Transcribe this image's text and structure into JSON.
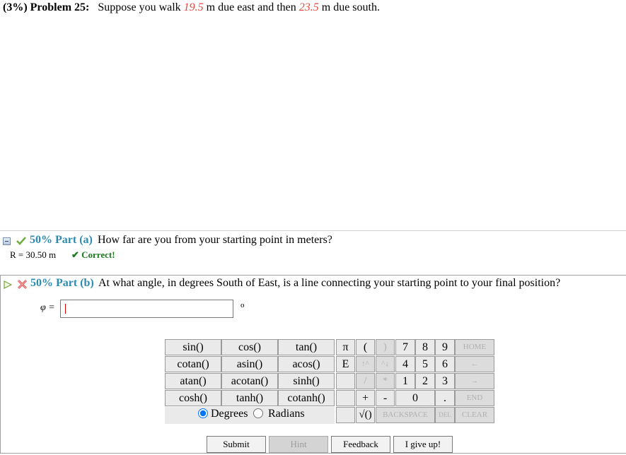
{
  "problem": {
    "points": "(3%)",
    "label": "Problem 25:",
    "text_1": "Suppose you walk",
    "east": "19.5",
    "text_2": "m due east and then",
    "south": "23.5",
    "text_3": "m due south."
  },
  "part_a": {
    "title": "50% Part (a)",
    "question": "How far are you from your starting point in meters?",
    "answer": "R = 30.50 m",
    "status": "✔ Correct!",
    "status_color": "#1a7a1a"
  },
  "part_b": {
    "title": "50% Part (b)",
    "question": "At what angle, in degrees South of East, is a line connecting your starting point to your final position?",
    "var_label": "φ =",
    "unit": "o",
    "input_value": ""
  },
  "keypad": {
    "functions": [
      [
        "sin()",
        "cos()",
        "tan()"
      ],
      [
        "cotan()",
        "asin()",
        "acos()"
      ],
      [
        "atan()",
        "acotan()",
        "sinh()"
      ],
      [
        "cosh()",
        "tanh()",
        "cotanh()"
      ]
    ],
    "degrees_label": "Degrees",
    "radians_label": "Radians",
    "mode": "Degrees",
    "keys": {
      "pi": "π",
      "lparen": "(",
      "rparen": ")",
      "e": "E",
      "up": "↑^",
      "down": "^↓",
      "divide": "/",
      "multiply": "*",
      "plus": "+",
      "minus": "-",
      "sqrt": "√()",
      "backspace": "BACKSPACE",
      "del": "DEL",
      "clear": "CLEAR",
      "home": "HOME",
      "left": "←",
      "right": "→",
      "end": "END",
      "n7": "7",
      "n8": "8",
      "n9": "9",
      "n4": "4",
      "n5": "5",
      "n6": "6",
      "n1": "1",
      "n2": "2",
      "n3": "3",
      "n0": "0",
      "dot": "."
    }
  },
  "buttons": {
    "submit": "Submit",
    "hint": "Hint",
    "feedback": "Feedback",
    "give_up": "I give up!"
  }
}
